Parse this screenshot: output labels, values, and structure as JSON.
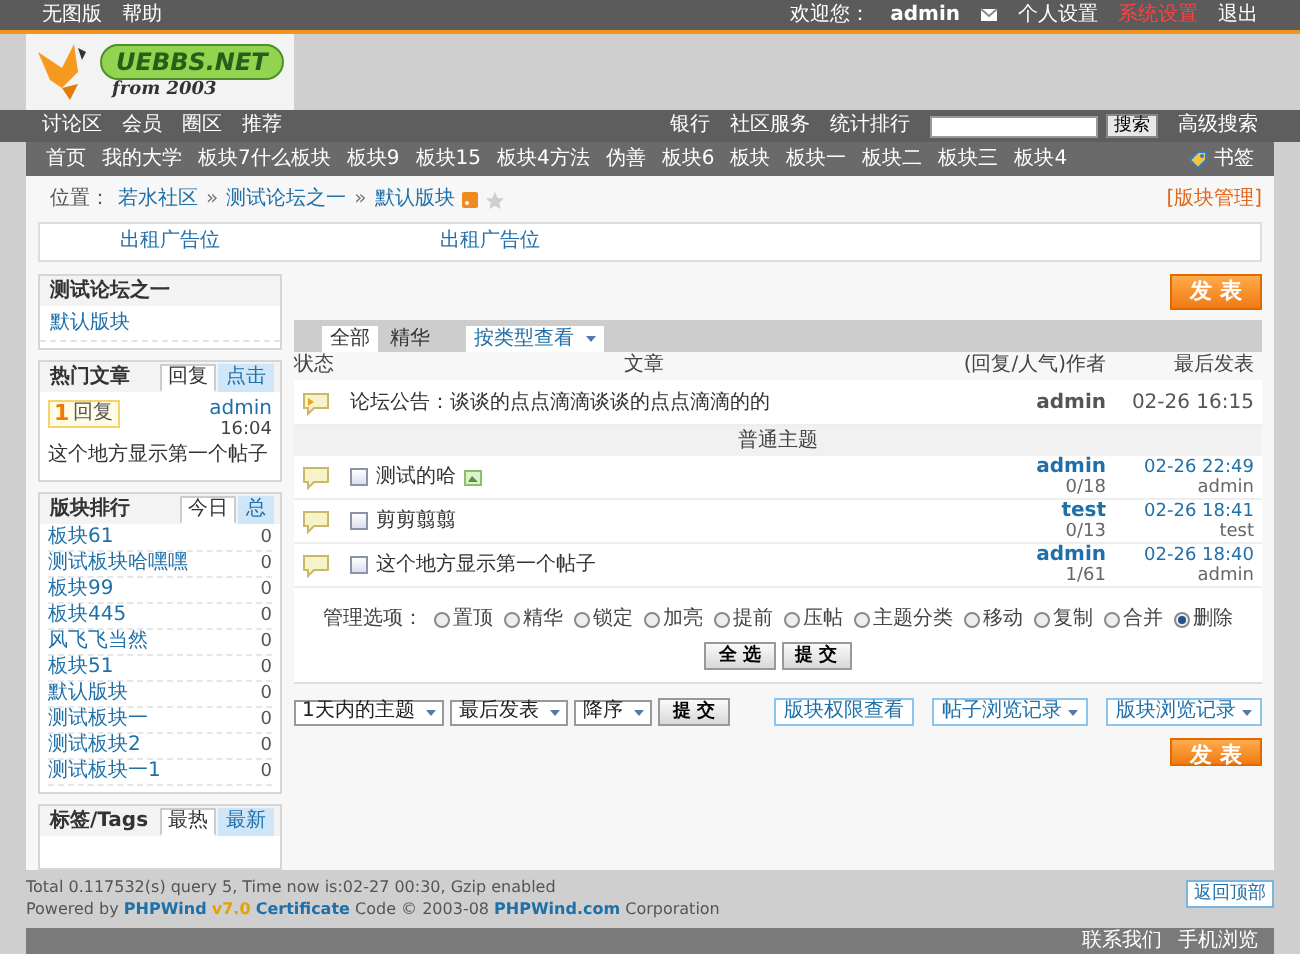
{
  "top_bar": {
    "left_links": [
      "无图版",
      "帮助"
    ],
    "welcome": "欢迎您：",
    "user": "admin",
    "links": [
      {
        "label": "个人设置",
        "kind": "normal"
      },
      {
        "label": "系统设置",
        "kind": "highlight"
      },
      {
        "label": "退出",
        "kind": "normal"
      }
    ]
  },
  "logo": {
    "wordmark": "UEBBS.NET",
    "tagline": "from 2003"
  },
  "nav": {
    "items": [
      "讨论区",
      "会员",
      "圈区",
      "推荐"
    ],
    "right_items": [
      "银行",
      "社区服务",
      "统计排行"
    ],
    "search_button": "搜索",
    "advanced_search": "高级搜索"
  },
  "forum_nav": {
    "items": [
      "首页",
      "我的大学",
      "板块7什么板块",
      "板块9",
      "板块15",
      "板块4方法",
      "伪善",
      "板块6",
      "板块",
      "板块一",
      "板块二",
      "板块三",
      "板块4"
    ],
    "bookmark": "书签"
  },
  "breadcrumb": {
    "label": "位置：",
    "path": [
      "若水社区",
      "测试论坛之一",
      "默认版块"
    ],
    "separator": "»",
    "manage": "[版块管理]"
  },
  "ads": [
    "出租广告位",
    "出租广告位"
  ],
  "sidebar": {
    "forum": {
      "title": "测试论坛之一",
      "items": [
        "默认版块"
      ]
    },
    "hot": {
      "title": "热门文章",
      "tabs": [
        {
          "label": "回复",
          "selected": true
        },
        {
          "label": "点击",
          "selected": false
        }
      ],
      "items": [
        {
          "rank": "1",
          "tag": "回复",
          "author": "admin",
          "time": "16:04",
          "title": "这个地方显示第一个帖子"
        }
      ]
    },
    "ranking": {
      "title": "版块排行",
      "tabs": [
        {
          "label": "今日",
          "selected": true
        },
        {
          "label": "总",
          "selected": false
        }
      ],
      "rows": [
        {
          "name": "板块61",
          "count": "0"
        },
        {
          "name": "测试板块哈嘿嘿",
          "count": "0"
        },
        {
          "name": "板块99",
          "count": "0"
        },
        {
          "name": "板块445",
          "count": "0"
        },
        {
          "name": "风飞飞当然",
          "count": "0"
        },
        {
          "name": "板块51",
          "count": "0"
        },
        {
          "name": "默认版块",
          "count": "0"
        },
        {
          "name": "测试板块一",
          "count": "0"
        },
        {
          "name": "测试板块2",
          "count": "0"
        },
        {
          "name": "测试板块一1",
          "count": "0"
        }
      ]
    },
    "tags": {
      "title": "标签/Tags",
      "tabs": [
        {
          "label": "最热",
          "selected": true
        },
        {
          "label": "最新",
          "selected": false
        }
      ]
    }
  },
  "threads": {
    "post_button": "发 表",
    "tabs": [
      {
        "label": "全部",
        "selected": true
      },
      {
        "label": "精华",
        "selected": false
      }
    ],
    "type_filter": "按类型查看",
    "columns": [
      "状态",
      "文章",
      "(回复/人气)作者",
      "最后发表"
    ],
    "announcement": {
      "title": "论坛公告：谈谈的点点滴滴谈谈的点点滴滴的的",
      "author": "admin",
      "time": "02-26 16:15"
    },
    "section": "普通主题",
    "rows": [
      {
        "title": "测试的哈",
        "has_image": true,
        "checked": false,
        "author": "admin",
        "counts": "0/18",
        "time": "02-26 22:49",
        "last_poster": "admin"
      },
      {
        "title": "剪剪翦翦",
        "has_image": false,
        "checked": false,
        "author": "test",
        "counts": "0/13",
        "time": "02-26 18:41",
        "last_poster": "test"
      },
      {
        "title": "这个地方显示第一个帖子",
        "has_image": false,
        "checked": false,
        "author": "admin",
        "counts": "1/61",
        "time": "02-26 18:40",
        "last_poster": "admin"
      }
    ]
  },
  "moderation": {
    "label": "管理选项：",
    "options": [
      {
        "label": "置顶",
        "selected": false
      },
      {
        "label": "精华",
        "selected": false
      },
      {
        "label": "锁定",
        "selected": false
      },
      {
        "label": "加亮",
        "selected": false
      },
      {
        "label": "提前",
        "selected": false
      },
      {
        "label": "压帖",
        "selected": false
      },
      {
        "label": "主题分类",
        "selected": false
      },
      {
        "label": "移动",
        "selected": false
      },
      {
        "label": "复制",
        "selected": false
      },
      {
        "label": "合并",
        "selected": false
      },
      {
        "label": "删除",
        "selected": true
      }
    ],
    "buttons": [
      "全 选",
      "提 交"
    ]
  },
  "filters": {
    "selects": [
      "1天内的主题",
      "最后发表",
      "降序"
    ],
    "submit": "提 交",
    "links": [
      {
        "label": "版块权限查看",
        "dropdown": false
      },
      {
        "label": "帖子浏览记录",
        "dropdown": true
      },
      {
        "label": "版块浏览记录",
        "dropdown": true
      }
    ],
    "post_button": "发 表"
  },
  "footer": {
    "stats": "Total 0.117532(s) query 5, Time now is:02-27 00:30, Gzip enabled",
    "powered": "Powered by **PHPWind** **v7.0** **Certificate** Code © 2003-08 **PHPWind.com** Corporation",
    "top_button": "返回顶部",
    "links": [
      "联系我们",
      "手机浏览"
    ]
  }
}
